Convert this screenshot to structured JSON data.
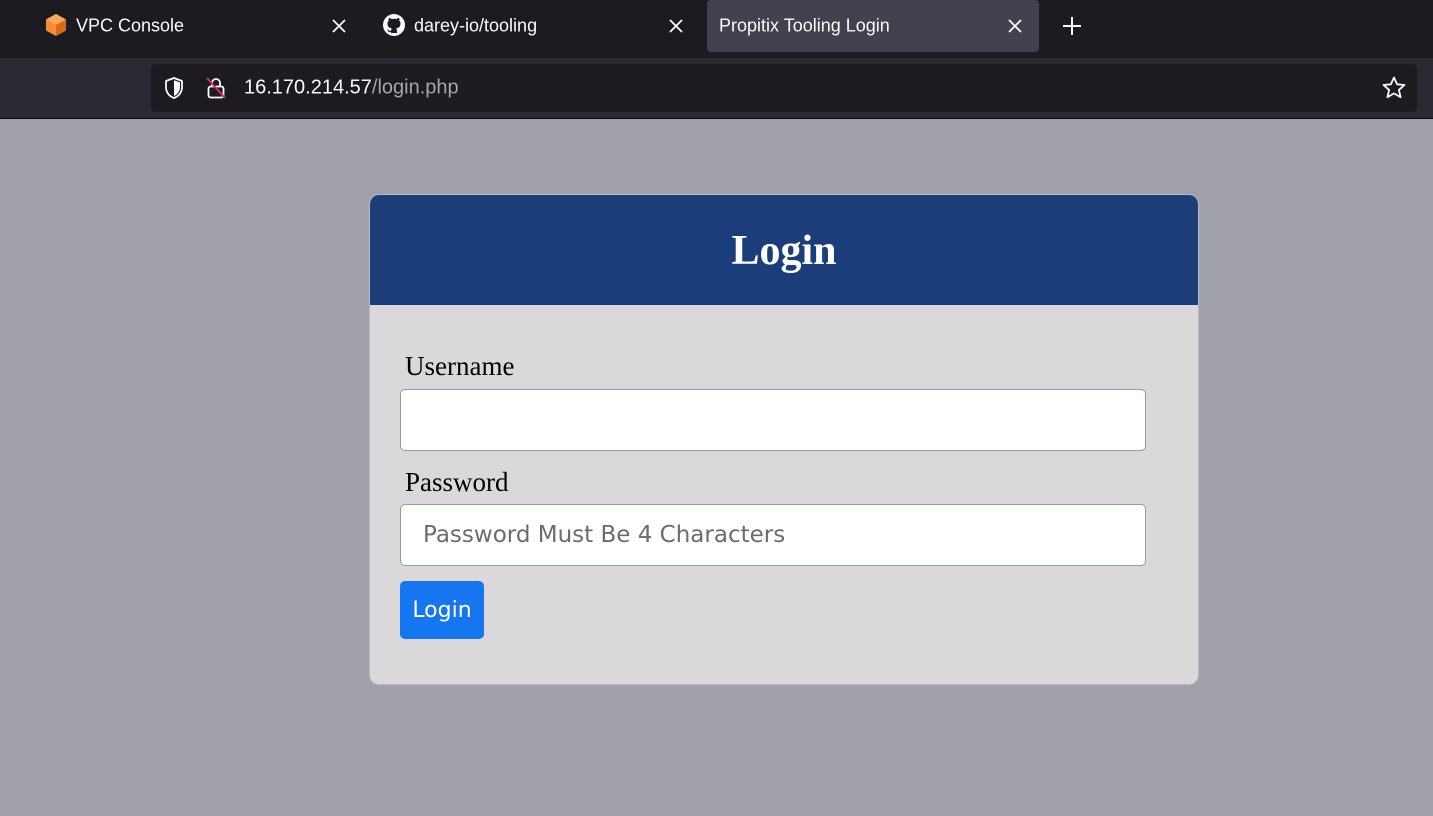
{
  "browser": {
    "tabs": [
      {
        "label": "VPC Console",
        "icon": "aws-vpc-cube-icon",
        "icon_color": "#f68d2e",
        "active": false
      },
      {
        "label": "darey-io/tooling",
        "icon": "github-icon",
        "active": false
      },
      {
        "label": "Propitix Tooling Login",
        "icon": "",
        "active": true
      }
    ],
    "url": {
      "host": "16.170.214.57",
      "path": "/login.php"
    }
  },
  "login": {
    "title": "Login",
    "username_label": "Username",
    "username_value": "",
    "password_label": "Password",
    "password_placeholder": "Password Must Be 4 Characters",
    "submit_label": "Login"
  },
  "colors": {
    "header": "#1b3e7a",
    "button": "#1576ef",
    "page_bg": "#a0a0ab",
    "card_bg": "#dad8da"
  }
}
